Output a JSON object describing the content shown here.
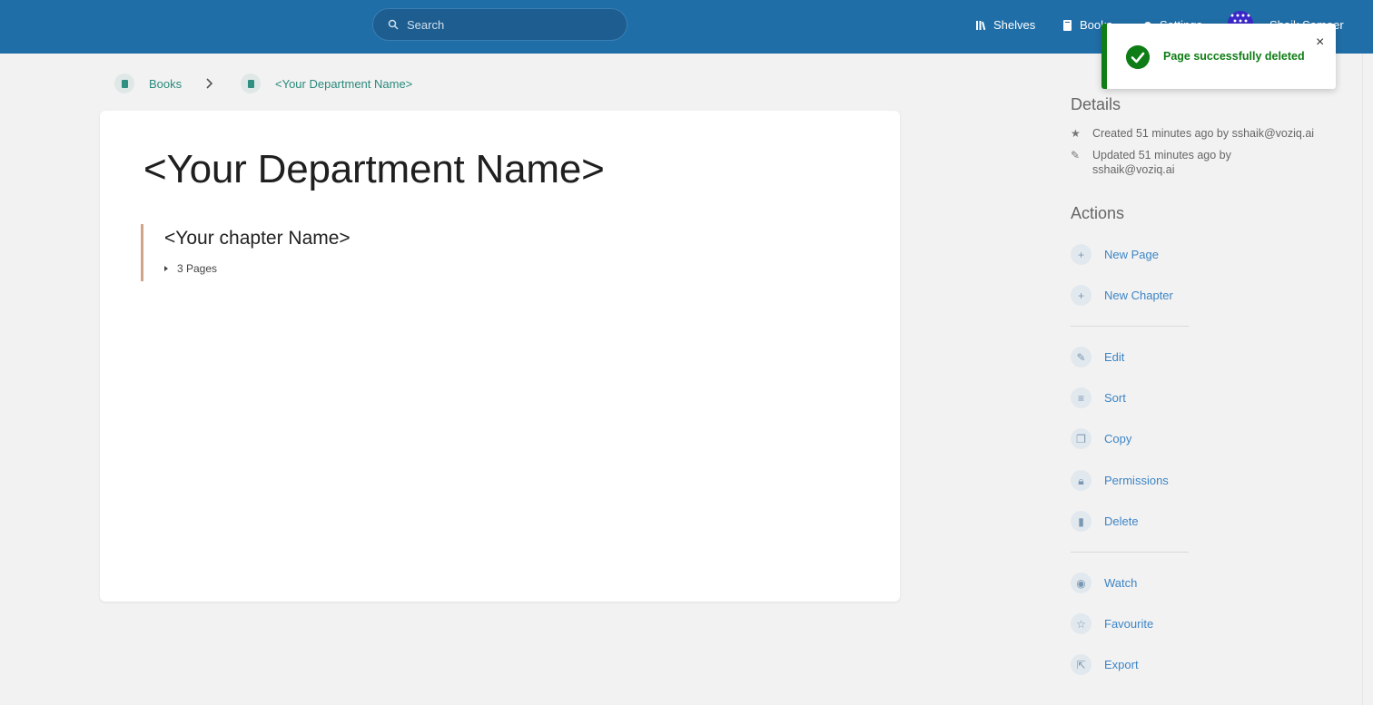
{
  "header": {
    "search_placeholder": "Search",
    "nav": {
      "shelves": "Shelves",
      "books": "Books",
      "settings": "Settings"
    },
    "user_name": "Shaik Sameer",
    "colors": {
      "bar": "#206ea7"
    }
  },
  "breadcrumb": {
    "books": "Books",
    "current": "<Your Department Name>"
  },
  "book": {
    "title": "<Your Department Name>",
    "chapter": {
      "name": "<Your chapter Name>",
      "pages": "3 Pages"
    }
  },
  "sidebar": {
    "details_title": "Details",
    "created": "Created 51 minutes ago by sshaik@voziq.ai",
    "updated": "Updated 51 minutes ago by sshaik@voziq.ai",
    "actions_title": "Actions",
    "actions": {
      "new_page": "New Page",
      "new_chapter": "New Chapter",
      "edit": "Edit",
      "sort": "Sort",
      "copy": "Copy",
      "permissions": "Permissions",
      "delete": "Delete",
      "watch": "Watch",
      "favourite": "Favourite",
      "export": "Export"
    }
  },
  "toast": {
    "message": "Page successfully deleted",
    "close": "×",
    "color": "#0f7d15"
  }
}
